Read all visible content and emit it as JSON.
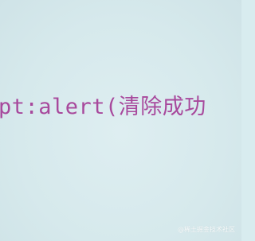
{
  "editor": {
    "code_text": "pt:alert(清除成功",
    "text_color": "#a43c96",
    "background_color": "#d8ecef"
  },
  "watermark": {
    "text": "@稀土掘金技术社区"
  }
}
